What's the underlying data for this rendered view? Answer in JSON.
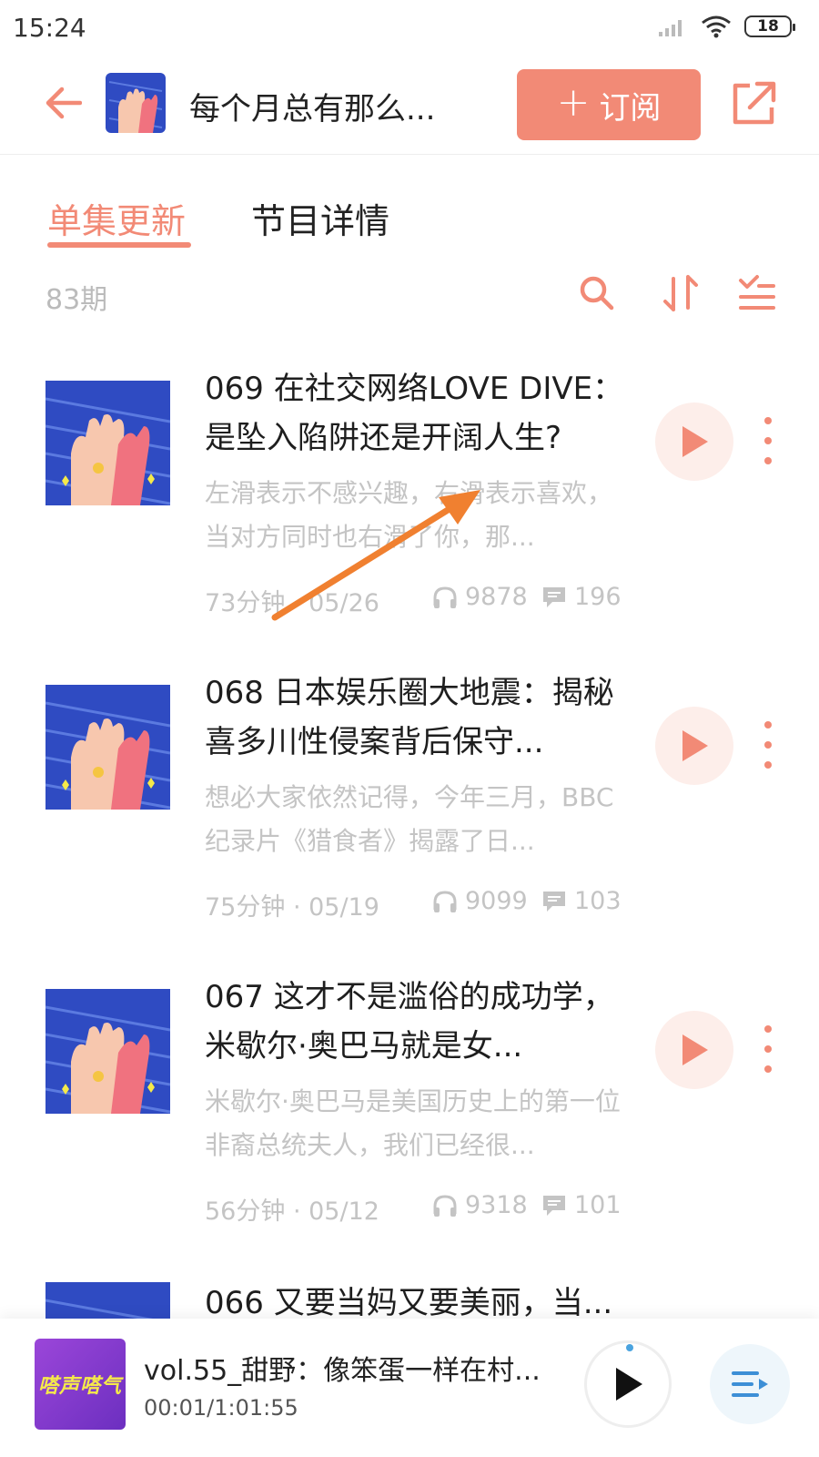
{
  "status_bar": {
    "time": "15:24",
    "battery": "18"
  },
  "header": {
    "title": "每个月总有那么...",
    "subscribe_label": "订阅",
    "subscribe_symbol": "+"
  },
  "tabs": [
    {
      "label": "单集更新",
      "active": true
    },
    {
      "label": "节目详情",
      "active": false
    }
  ],
  "toolbar": {
    "episode_count": "83期"
  },
  "episodes": [
    {
      "title": "069 在社交网络LOVE DIVE：是坠入陷阱还是开阔人生?",
      "description": "左滑表示不感兴趣，右滑表示喜欢，当对方同时也右滑了你，那...",
      "duration": "73分钟",
      "date": "05/26",
      "listens": "9878",
      "comments": "196"
    },
    {
      "title": "068 日本娱乐圈大地震：揭秘喜多川性侵案背后保守...",
      "description": "想必大家依然记得，今年三月，BBC纪录片《猎食者》揭露了日...",
      "duration": "75分钟",
      "date": "05/19",
      "listens": "9099",
      "comments": "103"
    },
    {
      "title": "067 这才不是滥俗的成功学，米歇尔·奥巴马就是女...",
      "description": "米歇尔·奥巴马是美国历史上的第一位非裔总统夫人，我们已经很...",
      "duration": "56分钟",
      "date": "05/12",
      "listens": "9318",
      "comments": "101"
    },
    {
      "title": "066 又要当妈又要美丽，当...",
      "description": "",
      "duration": "",
      "date": "",
      "listens": "",
      "comments": ""
    }
  ],
  "player": {
    "title": "vol.55_甜野：像笨蛋一样在村...",
    "time": "00:01/1:01:55",
    "cover_text": "嗒声嗒气"
  },
  "colors": {
    "accent": "#f28a76",
    "annotation_arrow": "#f08030"
  },
  "icons": [
    "back-arrow-icon",
    "share-icon",
    "search-icon",
    "sort-icon",
    "filter-icon",
    "play-icon",
    "more-icon",
    "headphones-icon",
    "comment-icon",
    "playlist-icon"
  ]
}
